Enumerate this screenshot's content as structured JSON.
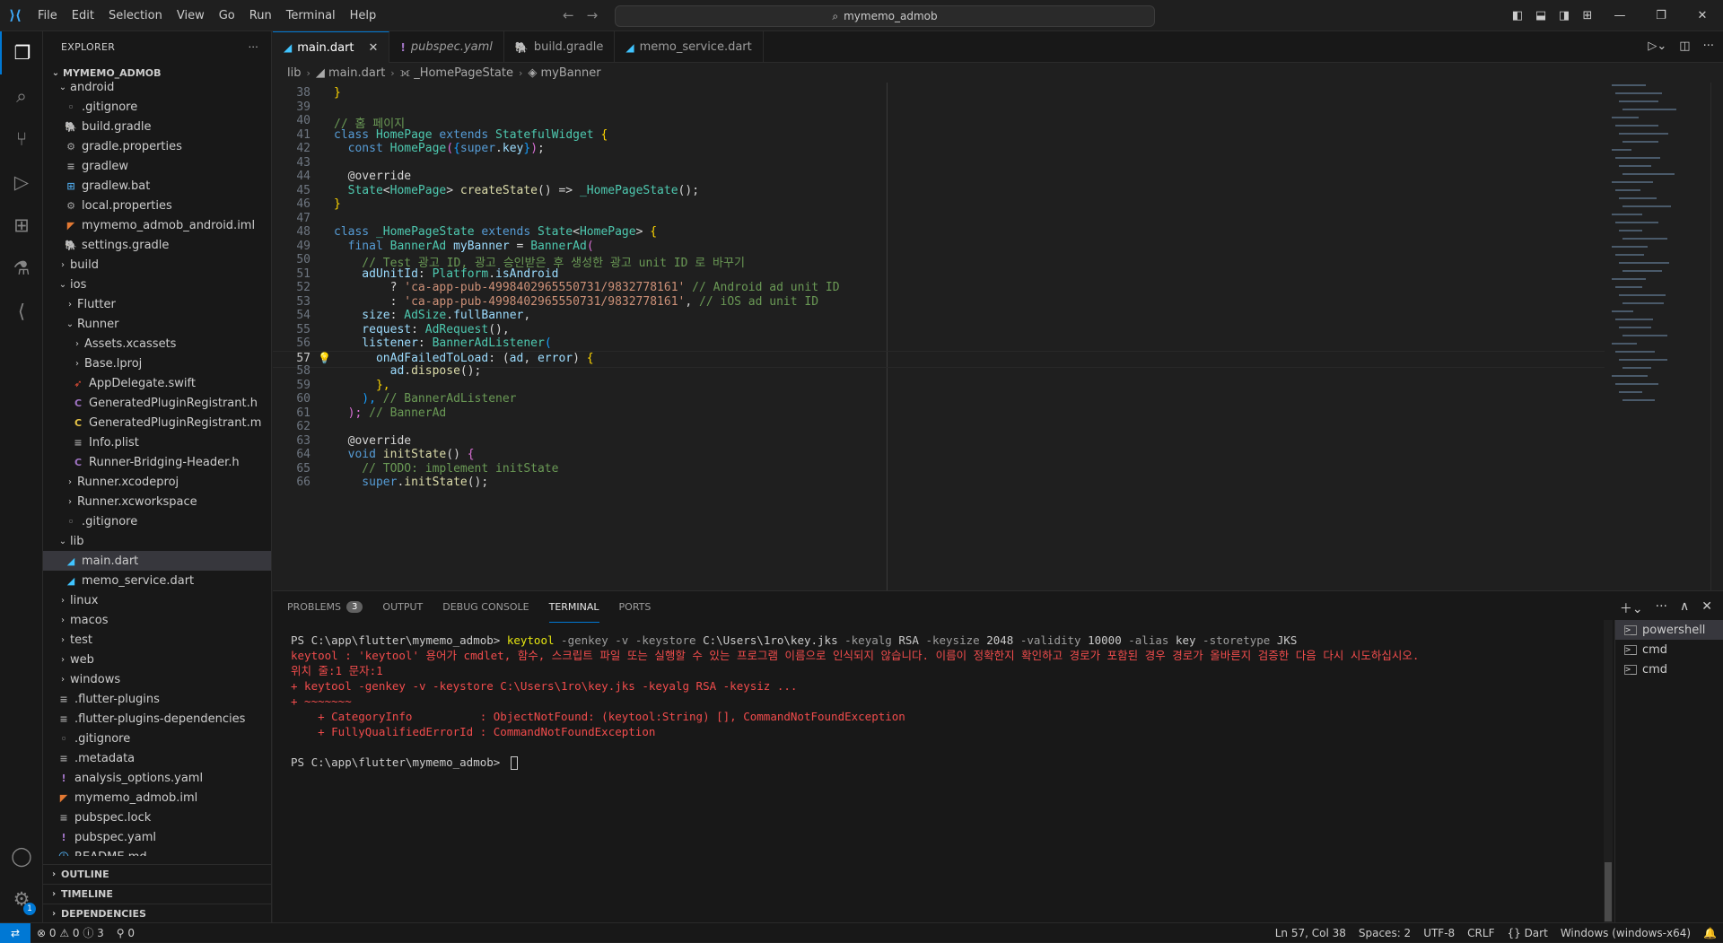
{
  "titlebar": {
    "menu": [
      "File",
      "Edit",
      "Selection",
      "View",
      "Go",
      "Run",
      "Terminal",
      "Help"
    ],
    "search": "mymemo_admob"
  },
  "activity": {
    "settings_badge": "1"
  },
  "explorer": {
    "title": "EXPLORER",
    "root": "MYMEMO_ADMOB",
    "items": [
      {
        "label": "android",
        "depth": 0,
        "chev": "down",
        "icon": "",
        "color": "#cccccc"
      },
      {
        "label": ".gitignore",
        "depth": 1,
        "chev": "",
        "icon": "◦",
        "color": "#888888"
      },
      {
        "label": "build.gradle",
        "depth": 1,
        "chev": "",
        "icon": "🐘",
        "color": "#5b8fb9"
      },
      {
        "label": "gradle.properties",
        "depth": 1,
        "chev": "",
        "icon": "⚙",
        "color": "#a0a0a0"
      },
      {
        "label": "gradlew",
        "depth": 1,
        "chev": "",
        "icon": "≡",
        "color": "#a0a0a0"
      },
      {
        "label": "gradlew.bat",
        "depth": 1,
        "chev": "",
        "icon": "⊞",
        "color": "#4da3e0"
      },
      {
        "label": "local.properties",
        "depth": 1,
        "chev": "",
        "icon": "⚙",
        "color": "#a0a0a0"
      },
      {
        "label": "mymemo_admob_android.iml",
        "depth": 1,
        "chev": "",
        "icon": "◤",
        "color": "#e37933"
      },
      {
        "label": "settings.gradle",
        "depth": 1,
        "chev": "",
        "icon": "🐘",
        "color": "#5b8fb9"
      },
      {
        "label": "build",
        "depth": 0,
        "chev": "right",
        "icon": "",
        "color": "#cccccc"
      },
      {
        "label": "ios",
        "depth": 0,
        "chev": "down",
        "icon": "",
        "color": "#cccccc"
      },
      {
        "label": "Flutter",
        "depth": 1,
        "chev": "right",
        "icon": "",
        "color": "#cccccc"
      },
      {
        "label": "Runner",
        "depth": 1,
        "chev": "down",
        "icon": "",
        "color": "#cccccc"
      },
      {
        "label": "Assets.xcassets",
        "depth": 2,
        "chev": "right",
        "icon": "",
        "color": "#cccccc"
      },
      {
        "label": "Base.lproj",
        "depth": 2,
        "chev": "right",
        "icon": "",
        "color": "#cccccc"
      },
      {
        "label": "AppDelegate.swift",
        "depth": 2,
        "chev": "",
        "icon": "➶",
        "color": "#f05138"
      },
      {
        "label": "GeneratedPluginRegistrant.h",
        "depth": 2,
        "chev": "",
        "icon": "C",
        "color": "#a074c4"
      },
      {
        "label": "GeneratedPluginRegistrant.m",
        "depth": 2,
        "chev": "",
        "icon": "C",
        "color": "#e8c547"
      },
      {
        "label": "Info.plist",
        "depth": 2,
        "chev": "",
        "icon": "≡",
        "color": "#a0a0a0"
      },
      {
        "label": "Runner-Bridging-Header.h",
        "depth": 2,
        "chev": "",
        "icon": "C",
        "color": "#a074c4"
      },
      {
        "label": "Runner.xcodeproj",
        "depth": 1,
        "chev": "right",
        "icon": "",
        "color": "#cccccc"
      },
      {
        "label": "Runner.xcworkspace",
        "depth": 1,
        "chev": "right",
        "icon": "",
        "color": "#cccccc"
      },
      {
        "label": ".gitignore",
        "depth": 1,
        "chev": "",
        "icon": "◦",
        "color": "#888888"
      },
      {
        "label": "lib",
        "depth": 0,
        "chev": "down",
        "icon": "",
        "color": "#cccccc"
      },
      {
        "label": "main.dart",
        "depth": 1,
        "chev": "",
        "icon": "◢",
        "color": "#40c4ff",
        "selected": true
      },
      {
        "label": "memo_service.dart",
        "depth": 1,
        "chev": "",
        "icon": "◢",
        "color": "#40c4ff"
      },
      {
        "label": "linux",
        "depth": 0,
        "chev": "right",
        "icon": "",
        "color": "#cccccc"
      },
      {
        "label": "macos",
        "depth": 0,
        "chev": "right",
        "icon": "",
        "color": "#cccccc"
      },
      {
        "label": "test",
        "depth": 0,
        "chev": "right",
        "icon": "",
        "color": "#cccccc"
      },
      {
        "label": "web",
        "depth": 0,
        "chev": "right",
        "icon": "",
        "color": "#cccccc"
      },
      {
        "label": "windows",
        "depth": 0,
        "chev": "right",
        "icon": "",
        "color": "#cccccc"
      },
      {
        "label": ".flutter-plugins",
        "depth": 0,
        "chev": "",
        "icon": "≡",
        "color": "#a0a0a0"
      },
      {
        "label": ".flutter-plugins-dependencies",
        "depth": 0,
        "chev": "",
        "icon": "≡",
        "color": "#a0a0a0"
      },
      {
        "label": ".gitignore",
        "depth": 0,
        "chev": "",
        "icon": "◦",
        "color": "#888888"
      },
      {
        "label": ".metadata",
        "depth": 0,
        "chev": "",
        "icon": "≡",
        "color": "#a0a0a0"
      },
      {
        "label": "analysis_options.yaml",
        "depth": 0,
        "chev": "",
        "icon": "!",
        "color": "#a074c4"
      },
      {
        "label": "mymemo_admob.iml",
        "depth": 0,
        "chev": "",
        "icon": "◤",
        "color": "#e37933"
      },
      {
        "label": "pubspec.lock",
        "depth": 0,
        "chev": "",
        "icon": "≡",
        "color": "#a0a0a0"
      },
      {
        "label": "pubspec.yaml",
        "depth": 0,
        "chev": "",
        "icon": "!",
        "color": "#a074c4"
      },
      {
        "label": "README.md",
        "depth": 0,
        "chev": "",
        "icon": "ⓘ",
        "color": "#4da3e0"
      }
    ],
    "sections": [
      "OUTLINE",
      "TIMELINE",
      "DEPENDENCIES"
    ]
  },
  "tabs": [
    {
      "label": "main.dart",
      "icon": "◢",
      "color": "#40c4ff",
      "active": true
    },
    {
      "label": "pubspec.yaml",
      "icon": "!",
      "color": "#a074c4",
      "italic": true
    },
    {
      "label": "build.gradle",
      "icon": "🐘",
      "color": "#5b8fb9"
    },
    {
      "label": "memo_service.dart",
      "icon": "◢",
      "color": "#40c4ff"
    }
  ],
  "breadcrumb": [
    "lib",
    "main.dart",
    "_HomePageState",
    "myBanner"
  ],
  "code": {
    "cursor_line": "57",
    "lines": [
      {
        "n": "38",
        "t": [
          [
            "}",
            "#ffd700"
          ]
        ]
      },
      {
        "n": "39",
        "t": []
      },
      {
        "n": "40",
        "t": [
          [
            "// 홈 페이지",
            "#6a9955"
          ]
        ]
      },
      {
        "n": "41",
        "t": [
          [
            "class ",
            "#569cd6"
          ],
          [
            "HomePage ",
            "#4ec9b0"
          ],
          [
            "extends ",
            "#569cd6"
          ],
          [
            "StatefulWidget ",
            "#4ec9b0"
          ],
          [
            "{",
            "#ffd700"
          ]
        ]
      },
      {
        "n": "42",
        "t": [
          [
            "  const ",
            "#569cd6"
          ],
          [
            "HomePage",
            "#4ec9b0"
          ],
          [
            "(",
            "#da70d6"
          ],
          [
            "{",
            "#179fff"
          ],
          [
            "super",
            "#569cd6"
          ],
          [
            ".",
            "#d4d4d4"
          ],
          [
            "key",
            "#9cdcfe"
          ],
          [
            "}",
            "#179fff"
          ],
          [
            ")",
            "#da70d6"
          ],
          [
            ";",
            "#d4d4d4"
          ]
        ]
      },
      {
        "n": "43",
        "t": []
      },
      {
        "n": "44",
        "t": [
          [
            "  @override",
            "#d4d4d4"
          ]
        ]
      },
      {
        "n": "45",
        "t": [
          [
            "  State",
            "#4ec9b0"
          ],
          [
            "<",
            "#d4d4d4"
          ],
          [
            "HomePage",
            "#4ec9b0"
          ],
          [
            "> ",
            "#d4d4d4"
          ],
          [
            "createState",
            "#dcdcaa"
          ],
          [
            "() => ",
            "#d4d4d4"
          ],
          [
            "_HomePageState",
            "#4ec9b0"
          ],
          [
            "();",
            "#d4d4d4"
          ]
        ]
      },
      {
        "n": "46",
        "t": [
          [
            "}",
            "#ffd700"
          ]
        ]
      },
      {
        "n": "47",
        "t": []
      },
      {
        "n": "48",
        "t": [
          [
            "class ",
            "#569cd6"
          ],
          [
            "_HomePageState ",
            "#4ec9b0"
          ],
          [
            "extends ",
            "#569cd6"
          ],
          [
            "State",
            "#4ec9b0"
          ],
          [
            "<",
            "#d4d4d4"
          ],
          [
            "HomePage",
            "#4ec9b0"
          ],
          [
            "> ",
            "#d4d4d4"
          ],
          [
            "{",
            "#ffd700"
          ]
        ]
      },
      {
        "n": "49",
        "t": [
          [
            "  final ",
            "#569cd6"
          ],
          [
            "BannerAd ",
            "#4ec9b0"
          ],
          [
            "myBanner ",
            "#9cdcfe"
          ],
          [
            "= ",
            "#d4d4d4"
          ],
          [
            "BannerAd",
            "#4ec9b0"
          ],
          [
            "(",
            "#da70d6"
          ]
        ]
      },
      {
        "n": "50",
        "t": [
          [
            "    // Test 광고 ID, 광고 승인받은 후 생성한 광고 unit ID 로 바꾸기",
            "#6a9955"
          ]
        ]
      },
      {
        "n": "51",
        "t": [
          [
            "    adUnitId",
            "#9cdcfe"
          ],
          [
            ": ",
            "#d4d4d4"
          ],
          [
            "Platform",
            "#4ec9b0"
          ],
          [
            ".",
            "#d4d4d4"
          ],
          [
            "isAndroid",
            "#9cdcfe"
          ]
        ]
      },
      {
        "n": "52",
        "t": [
          [
            "        ? ",
            "#d4d4d4"
          ],
          [
            "'ca-app-pub-4998402965550731/9832778161'",
            "#ce9178"
          ],
          [
            " // Android ad unit ID",
            "#6a9955"
          ]
        ]
      },
      {
        "n": "53",
        "t": [
          [
            "        : ",
            "#d4d4d4"
          ],
          [
            "'ca-app-pub-4998402965550731/9832778161'",
            "#ce9178"
          ],
          [
            ", ",
            "#d4d4d4"
          ],
          [
            "// iOS ad unit ID",
            "#6a9955"
          ]
        ]
      },
      {
        "n": "54",
        "t": [
          [
            "    size",
            "#9cdcfe"
          ],
          [
            ": ",
            "#d4d4d4"
          ],
          [
            "AdSize",
            "#4ec9b0"
          ],
          [
            ".",
            "#d4d4d4"
          ],
          [
            "fullBanner",
            "#9cdcfe"
          ],
          [
            ",",
            "#d4d4d4"
          ]
        ]
      },
      {
        "n": "55",
        "t": [
          [
            "    request",
            "#9cdcfe"
          ],
          [
            ": ",
            "#d4d4d4"
          ],
          [
            "AdRequest",
            "#4ec9b0"
          ],
          [
            "(),",
            "#d4d4d4"
          ]
        ]
      },
      {
        "n": "56",
        "t": [
          [
            "    listener",
            "#9cdcfe"
          ],
          [
            ": ",
            "#d4d4d4"
          ],
          [
            "BannerAdListener",
            "#4ec9b0"
          ],
          [
            "(",
            "#179fff"
          ]
        ]
      },
      {
        "n": "57",
        "t": [
          [
            "      onAdFailedToLoad",
            "#9cdcfe"
          ],
          [
            ": (",
            "#d4d4d4"
          ],
          [
            "ad",
            "#9cdcfe"
          ],
          [
            ", ",
            "#d4d4d4"
          ],
          [
            "error",
            "#9cdcfe"
          ],
          [
            ") ",
            "#d4d4d4"
          ],
          [
            "{",
            "#ffd700"
          ]
        ]
      },
      {
        "n": "58",
        "t": [
          [
            "        ad",
            "#9cdcfe"
          ],
          [
            ".",
            "#d4d4d4"
          ],
          [
            "dispose",
            "#dcdcaa"
          ],
          [
            "();",
            "#d4d4d4"
          ]
        ]
      },
      {
        "n": "59",
        "t": [
          [
            "      },",
            "#ffd700"
          ]
        ]
      },
      {
        "n": "60",
        "t": [
          [
            "    ), ",
            "#179fff"
          ],
          [
            "// BannerAdListener",
            "#6a9955"
          ]
        ]
      },
      {
        "n": "61",
        "t": [
          [
            "  ); ",
            "#da70d6"
          ],
          [
            "// BannerAd",
            "#6a9955"
          ]
        ]
      },
      {
        "n": "62",
        "t": []
      },
      {
        "n": "63",
        "t": [
          [
            "  @override",
            "#d4d4d4"
          ]
        ]
      },
      {
        "n": "64",
        "t": [
          [
            "  void ",
            "#569cd6"
          ],
          [
            "initState",
            "#dcdcaa"
          ],
          [
            "() ",
            "#d4d4d4"
          ],
          [
            "{",
            "#da70d6"
          ]
        ]
      },
      {
        "n": "65",
        "t": [
          [
            "    // ",
            "#6a9955"
          ],
          [
            "TODO: implement initState",
            "#6a9955"
          ]
        ]
      },
      {
        "n": "66",
        "t": [
          [
            "    super",
            "#569cd6"
          ],
          [
            ".",
            "#d4d4d4"
          ],
          [
            "initState",
            "#dcdcaa"
          ],
          [
            "();",
            "#d4d4d4"
          ]
        ]
      }
    ]
  },
  "panel": {
    "tabs": [
      {
        "label": "PROBLEMS",
        "count": "3"
      },
      {
        "label": "OUTPUT"
      },
      {
        "label": "DEBUG CONSOLE"
      },
      {
        "label": "TERMINAL",
        "active": true
      },
      {
        "label": "PORTS"
      }
    ],
    "terminal": [
      [
        [
          "PS C:\\app\\flutter\\mymemo_admob> ",
          "#cccccc"
        ],
        [
          "keytool",
          "#e5e510"
        ],
        [
          " -genkey -v -keystore ",
          "#9d9d9d"
        ],
        [
          "C:\\Users\\1ro\\key.jks",
          "#cccccc"
        ],
        [
          " -keyalg ",
          "#9d9d9d"
        ],
        [
          "RSA",
          "#cccccc"
        ],
        [
          " -keysize ",
          "#9d9d9d"
        ],
        [
          "2048",
          "#cccccc"
        ],
        [
          " -validity ",
          "#9d9d9d"
        ],
        [
          "10000",
          "#cccccc"
        ],
        [
          " -alias ",
          "#9d9d9d"
        ],
        [
          "key",
          "#cccccc"
        ],
        [
          " -storetype ",
          "#9d9d9d"
        ],
        [
          "JKS",
          "#cccccc"
        ]
      ],
      [
        [
          "keytool : 'keytool' 용어가 cmdlet, 함수, 스크립트 파일 또는 실행할 수 있는 프로그램 이름으로 인식되지 않습니다. 이름이 정확한지 확인하고 경로가 포함된 경우 경로가 올바른지 검증한 다음 다시 시도하십시오.",
          "#f14c4c"
        ]
      ],
      [
        [
          "위치 줄:1 문자:1",
          "#f14c4c"
        ]
      ],
      [
        [
          "+ keytool -genkey -v -keystore C:\\Users\\1ro\\key.jks -keyalg RSA -keysiz ...",
          "#f14c4c"
        ]
      ],
      [
        [
          "+ ~~~~~~~",
          "#f14c4c"
        ]
      ],
      [
        [
          "    + CategoryInfo          : ObjectNotFound: (keytool:String) [], CommandNotFoundException",
          "#f14c4c"
        ]
      ],
      [
        [
          "    + FullyQualifiedErrorId : CommandNotFoundException",
          "#f14c4c"
        ]
      ],
      [],
      [
        [
          "PS C:\\app\\flutter\\mymemo_admob> ",
          "#cccccc"
        ]
      ]
    ],
    "terminals": [
      {
        "label": "powershell",
        "active": true
      },
      {
        "label": "cmd"
      },
      {
        "label": "cmd"
      }
    ]
  },
  "status": {
    "problems": "⊗ 0 ⚠ 0 ⓘ 3",
    "ports": "⚲ 0",
    "cursor": "Ln 57, Col 38",
    "spaces": "Spaces: 2",
    "encoding": "UTF-8",
    "eol": "CRLF",
    "language": "{} Dart",
    "platform": "Windows (windows-x64)"
  }
}
